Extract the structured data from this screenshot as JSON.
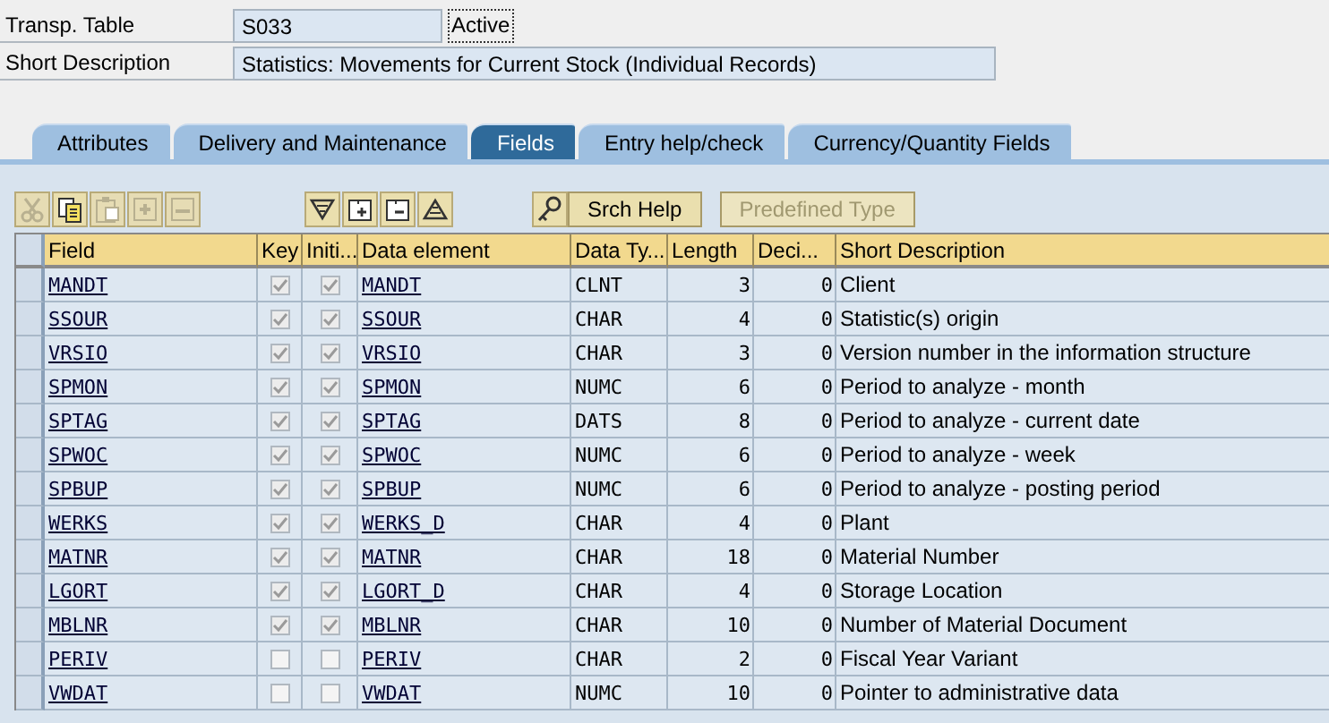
{
  "table_name": {
    "label": "Transp. Table",
    "value": "S033",
    "status": "Active"
  },
  "short_description": {
    "label": "Short Description",
    "value": "Statistics: Movements for Current Stock (Individual Records)"
  },
  "tabs": [
    {
      "label": "Attributes",
      "selected": false
    },
    {
      "label": "Delivery and Maintenance",
      "selected": false
    },
    {
      "label": "Fields",
      "selected": true
    },
    {
      "label": "Entry help/check",
      "selected": false
    },
    {
      "label": "Currency/Quantity Fields",
      "selected": false
    }
  ],
  "toolbar": {
    "icon_groups": [
      [
        {
          "kind": "cut",
          "disabled": true
        },
        {
          "kind": "copy",
          "disabled": false
        },
        {
          "kind": "paste",
          "disabled": true
        },
        {
          "kind": "insert",
          "disabled": true
        },
        {
          "kind": "delete",
          "disabled": true
        }
      ],
      [
        {
          "kind": "down",
          "disabled": false
        },
        {
          "kind": "plus",
          "disabled": false
        },
        {
          "kind": "minus",
          "disabled": false
        },
        {
          "kind": "up",
          "disabled": false
        }
      ],
      [
        {
          "kind": "key",
          "disabled": false
        }
      ]
    ],
    "buttons": [
      {
        "label": "Srch Help",
        "disabled": false
      },
      {
        "label": "Predefined Type",
        "disabled": true
      }
    ]
  },
  "table": {
    "columns": [
      "Field",
      "Key",
      "Initi...",
      "Data element",
      "Data Ty...",
      "Length",
      "Deci...",
      "Short Description"
    ],
    "rows": [
      {
        "field": "MANDT",
        "key": true,
        "initial": true,
        "data_element": "MANDT",
        "data_type": "CLNT",
        "length": "3",
        "decimals": "0",
        "short_description": "Client"
      },
      {
        "field": "SSOUR",
        "key": true,
        "initial": true,
        "data_element": "SSOUR",
        "data_type": "CHAR",
        "length": "4",
        "decimals": "0",
        "short_description": "Statistic(s) origin"
      },
      {
        "field": "VRSIO",
        "key": true,
        "initial": true,
        "data_element": "VRSIO",
        "data_type": "CHAR",
        "length": "3",
        "decimals": "0",
        "short_description": "Version number in the information structure"
      },
      {
        "field": "SPMON",
        "key": true,
        "initial": true,
        "data_element": "SPMON",
        "data_type": "NUMC",
        "length": "6",
        "decimals": "0",
        "short_description": "Period to analyze - month"
      },
      {
        "field": "SPTAG",
        "key": true,
        "initial": true,
        "data_element": "SPTAG",
        "data_type": "DATS",
        "length": "8",
        "decimals": "0",
        "short_description": "Period to analyze - current date"
      },
      {
        "field": "SPWOC",
        "key": true,
        "initial": true,
        "data_element": "SPWOC",
        "data_type": "NUMC",
        "length": "6",
        "decimals": "0",
        "short_description": "Period to analyze - week"
      },
      {
        "field": "SPBUP",
        "key": true,
        "initial": true,
        "data_element": "SPBUP",
        "data_type": "NUMC",
        "length": "6",
        "decimals": "0",
        "short_description": "Period to analyze - posting period"
      },
      {
        "field": "WERKS",
        "key": true,
        "initial": true,
        "data_element": "WERKS_D",
        "data_type": "CHAR",
        "length": "4",
        "decimals": "0",
        "short_description": "Plant"
      },
      {
        "field": "MATNR",
        "key": true,
        "initial": true,
        "data_element": "MATNR",
        "data_type": "CHAR",
        "length": "18",
        "decimals": "0",
        "short_description": "Material Number"
      },
      {
        "field": "LGORT",
        "key": true,
        "initial": true,
        "data_element": "LGORT_D",
        "data_type": "CHAR",
        "length": "4",
        "decimals": "0",
        "short_description": "Storage Location"
      },
      {
        "field": "MBLNR",
        "key": true,
        "initial": true,
        "data_element": "MBLNR",
        "data_type": "CHAR",
        "length": "10",
        "decimals": "0",
        "short_description": "Number of Material Document"
      },
      {
        "field": "PERIV",
        "key": false,
        "initial": false,
        "data_element": "PERIV",
        "data_type": "CHAR",
        "length": "2",
        "decimals": "0",
        "short_description": "Fiscal Year Variant"
      },
      {
        "field": "VWDAT",
        "key": false,
        "initial": false,
        "data_element": "VWDAT",
        "data_type": "NUMC",
        "length": "10",
        "decimals": "0",
        "short_description": "Pointer to administrative data"
      }
    ]
  }
}
